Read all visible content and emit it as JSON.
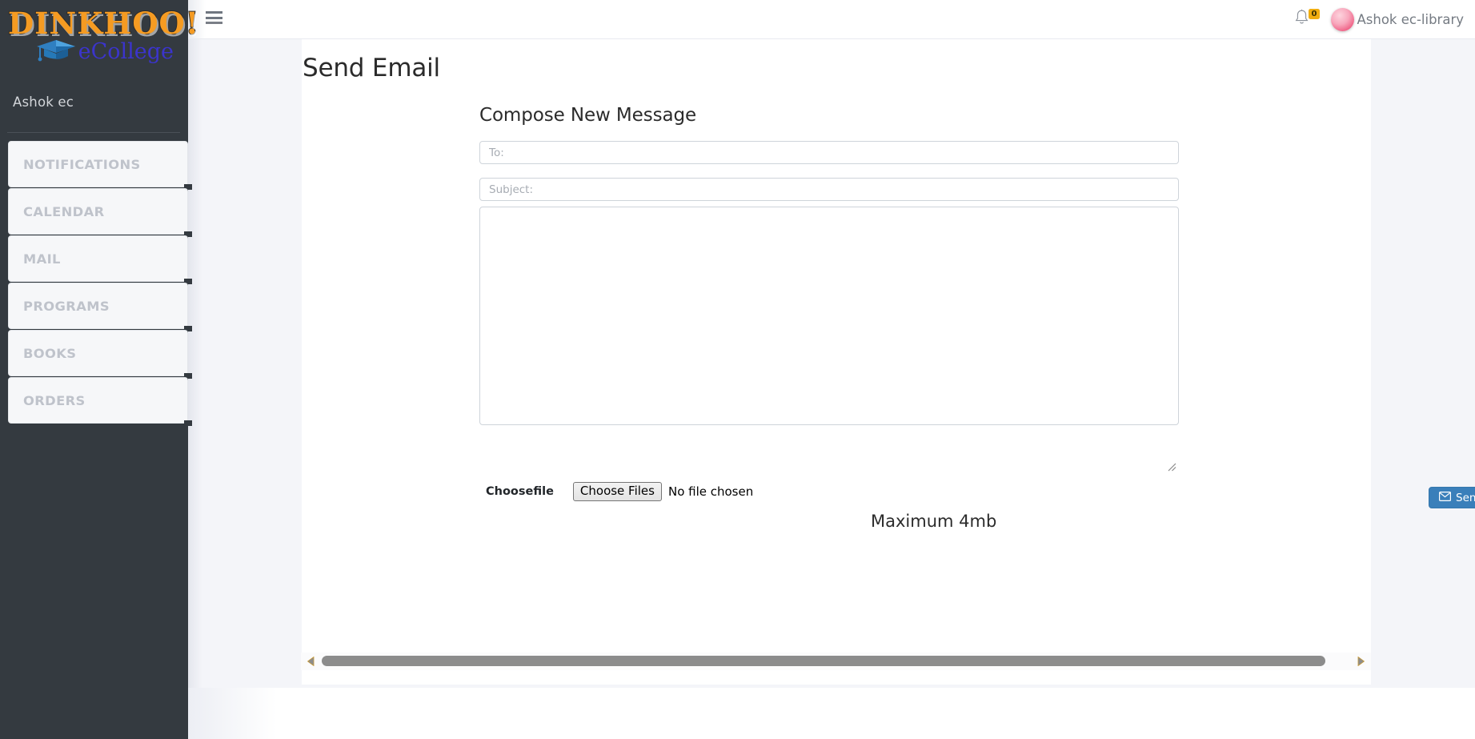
{
  "brand": {
    "logo_primary": "DINKHOO!",
    "logo_secondary": "eCollege",
    "cap_icon": "graduation-cap-icon"
  },
  "sidebar": {
    "user_label": "Ashok ec",
    "items": [
      {
        "label": "NOTIFICATIONS"
      },
      {
        "label": "CALENDAR"
      },
      {
        "label": "MAIL"
      },
      {
        "label": "PROGRAMS"
      },
      {
        "label": "BOOKS"
      },
      {
        "label": "ORDERS"
      }
    ]
  },
  "header": {
    "menu_icon": "hamburger-menu-icon",
    "bell_icon": "notification-bell-icon",
    "bell_count": "0",
    "avatar_icon": "user-avatar",
    "user_name": "Ashok ec-library"
  },
  "main": {
    "page_title": "Send Email",
    "compose_heading": "Compose New Message",
    "to_field": {
      "value": "",
      "placeholder": "To:"
    },
    "subject_field": {
      "value": "",
      "placeholder": "Subject:"
    },
    "message_field": {
      "value": "",
      "placeholder": ""
    },
    "file_label": "Choosefile",
    "choose_button": "Choose Files",
    "no_file_text": "No file chosen",
    "max_size_note": "Maximum 4mb",
    "send_button": "Send",
    "send_icon": "envelope-icon"
  },
  "scrollbar": {
    "left_arrow": "scroll-left-arrow-icon",
    "right_arrow": "scroll-right-arrow-icon"
  },
  "colors": {
    "sidebar_bg": "#343a40",
    "accent_blue": "#3a7fba",
    "badge_yellow": "#f0ad10",
    "logo_orange": "#F59B22",
    "logo_blue": "#3B34CC",
    "page_bg": "#f4f5f9"
  }
}
